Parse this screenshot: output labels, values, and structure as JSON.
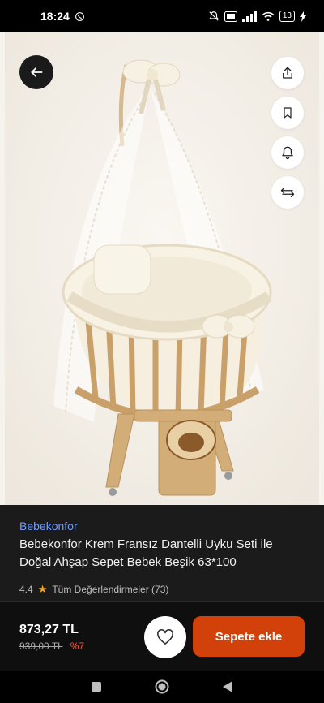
{
  "status_bar": {
    "time": "18:24",
    "battery": "13",
    "icons": [
      "whatsapp-icon",
      "mute-icon",
      "volte-icon",
      "signal-icon",
      "wifi-icon",
      "battery-icon",
      "charging-icon"
    ]
  },
  "product": {
    "brand": "Bebekonfor",
    "title": "Bebekonfor Krem Fransız Dantelli Uyku Seti ile Doğal Ahşap Sepet Bebek Beşik 63*100",
    "rating": "4.4",
    "reviews_link": "Tüm Değerlendirmeler (73)"
  },
  "pricing": {
    "price": "873,27 TL",
    "old_price": "939,00 TL",
    "discount": "%7"
  },
  "actions": {
    "add_to_cart": "Sepete ekle"
  },
  "colors": {
    "accent_orange": "#d3410b",
    "brand_blue": "#6e9cff",
    "star": "#f2a22b",
    "discount_red": "#ff5a3c"
  }
}
